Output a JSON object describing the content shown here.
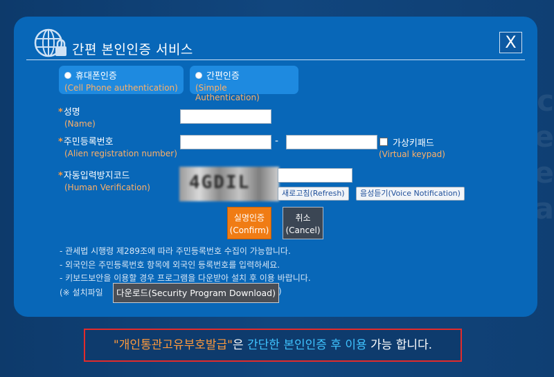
{
  "dialog": {
    "title": "간편 본인인증 서비스",
    "close_label": "X"
  },
  "methods": [
    {
      "label": "휴대폰인증",
      "sub": "(Cell Phone authentication)"
    },
    {
      "label": "간편인증",
      "sub": "(Simple Authentication)"
    }
  ],
  "form": {
    "name": {
      "star": "*",
      "label": "성명",
      "sub": "(Name)",
      "value": ""
    },
    "alien": {
      "star": "*",
      "label": "주민등록번호",
      "sub": "(Alien registration number)",
      "value1": "",
      "value2": "",
      "dash": "-"
    },
    "keypad": {
      "label": "가상키패드",
      "sub": "(Virtual keypad)"
    },
    "captcha": {
      "star": "*",
      "label": "자동입력방지코드",
      "sub": "(Human Verification)",
      "value": "",
      "glyphs": "4GDIL"
    },
    "refresh_label": "새로고침(Refresh)",
    "voice_label": "음성듣기(Voice Notification)"
  },
  "actions": {
    "confirm_line1": "실명인증",
    "confirm_line2": "(Confirm)",
    "cancel_line1": "취소",
    "cancel_line2": "(Cancel)"
  },
  "notes": [
    "- 관세법 시행령 제289조에 따라 주민등록번호 수집이 가능합니다.",
    "- 외국인은 주민등록번호 항목에 외국인 등록번호를 입력하세요.",
    "- 키보드보안을 이용할 경우 프로그램을 다운받아 설치 후 이용 바랍니다."
  ],
  "download": {
    "prefix": "(※ 설치파일",
    "button_label": "다운로드(Security Program Download)",
    "suffix": ")"
  },
  "banner": {
    "part1": "\"개인통관고유부호발급\"",
    "part2": "은 ",
    "part3": "간단한 본인인증 후 이용",
    "part4": " 가능 합니다."
  },
  "colors": {
    "dialog_bg": "#0867b8",
    "accent_orange": "#f07c14",
    "banner_border": "#e32b2b",
    "highlight_cyan": "#3fc3ff"
  }
}
